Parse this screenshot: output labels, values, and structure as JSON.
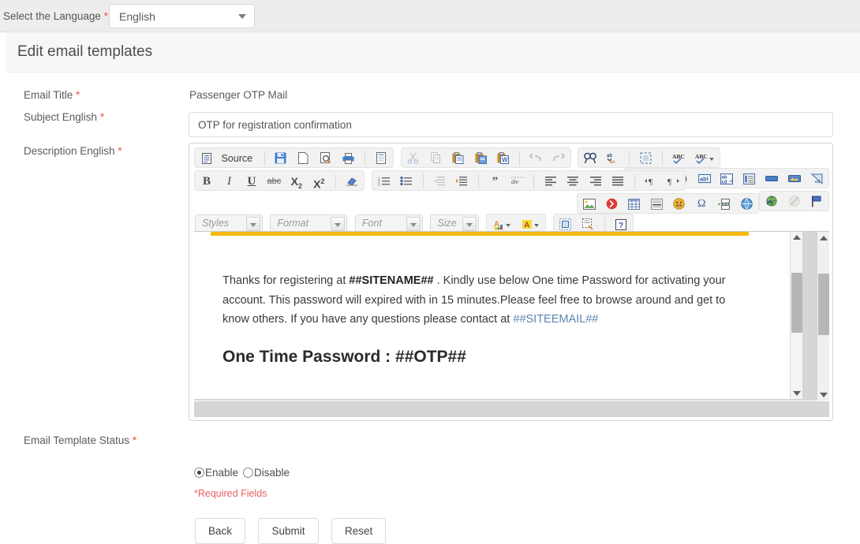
{
  "language_bar": {
    "label": "Select the Language",
    "required_mark": "*",
    "selected": "English"
  },
  "page": {
    "title": "Edit email templates"
  },
  "form": {
    "email_title": {
      "label": "Email Title",
      "required_mark": "*",
      "value": "Passenger OTP Mail"
    },
    "subject": {
      "label": "Subject English",
      "required_mark": "*",
      "value": "OTP for registration confirmation"
    },
    "description": {
      "label": "Description English",
      "required_mark": "*"
    },
    "status": {
      "label": "Email Template Status",
      "required_mark": "*",
      "options": [
        {
          "label": "Enable",
          "selected": true
        },
        {
          "label": "Disable",
          "selected": false
        }
      ]
    },
    "required_note": "*Required Fields",
    "buttons": [
      {
        "label": "Back",
        "name": "back-button"
      },
      {
        "label": "Submit",
        "name": "submit-button"
      },
      {
        "label": "Reset",
        "name": "reset-button"
      }
    ]
  },
  "editor": {
    "source_label": "Source",
    "combos": [
      {
        "name": "styles",
        "placeholder": "Styles"
      },
      {
        "name": "format",
        "placeholder": "Format"
      },
      {
        "name": "font",
        "placeholder": "Font"
      },
      {
        "name": "size",
        "placeholder": "Size"
      }
    ],
    "toolbar_row1": [
      "source-icon",
      "save-icon",
      "new-page-icon",
      "preview-icon",
      "print-icon",
      "templates-icon",
      "cut-icon",
      "copy-icon",
      "paste-icon",
      "paste-text-icon",
      "paste-word-icon",
      "undo-icon",
      "redo-icon",
      "find-icon",
      "replace-icon",
      "select-all-icon",
      "spellcheck-icon",
      "spellcheck-options-icon",
      "form-icon",
      "checkbox-icon",
      "radio-icon",
      "text-field-icon",
      "textarea-icon",
      "select-field-icon",
      "button-icon",
      "image-button-icon",
      "hidden-field-icon"
    ],
    "toolbar_row2": [
      "bold-icon",
      "italic-icon",
      "underline-icon",
      "strikethrough-icon",
      "subscript-icon",
      "superscript-icon",
      "remove-format-icon",
      "numbered-list-icon",
      "bulleted-list-icon",
      "decrease-indent-icon",
      "increase-indent-icon",
      "blockquote-icon",
      "div-container-icon",
      "align-left-icon",
      "align-center-icon",
      "align-right-icon",
      "justify-icon",
      "ltr-icon",
      "rtl-icon",
      "link-icon",
      "unlink-icon",
      "anchor-icon"
    ],
    "toolbar_row3": [
      "image-icon",
      "flash-icon",
      "table-icon",
      "horizontal-rule-icon",
      "smiley-icon",
      "special-char-icon",
      "page-break-icon",
      "iframe-icon",
      "text-color-icon",
      "bg-color-icon",
      "maximize-icon",
      "show-blocks-icon",
      "about-icon"
    ],
    "content": {
      "paragraph_part1": "Thanks for registering at ",
      "paragraph_sitename": "##SITENAME##",
      "paragraph_part2": " . Kindly use below One time Password for activating your account. This password will expired with in 15 minutes.Please feel free to browse around and get to know others. If you have any questions please contact at ",
      "paragraph_siteemail": "##SITEEMAIL##",
      "otp_heading": "One Time Password : ##OTP##"
    }
  },
  "colors": {
    "accent_bar": "#f6b910",
    "required": "#e8543f",
    "required_note": "#ec5f5f",
    "link": "#5b86b3",
    "page_bg": "#ededed"
  }
}
